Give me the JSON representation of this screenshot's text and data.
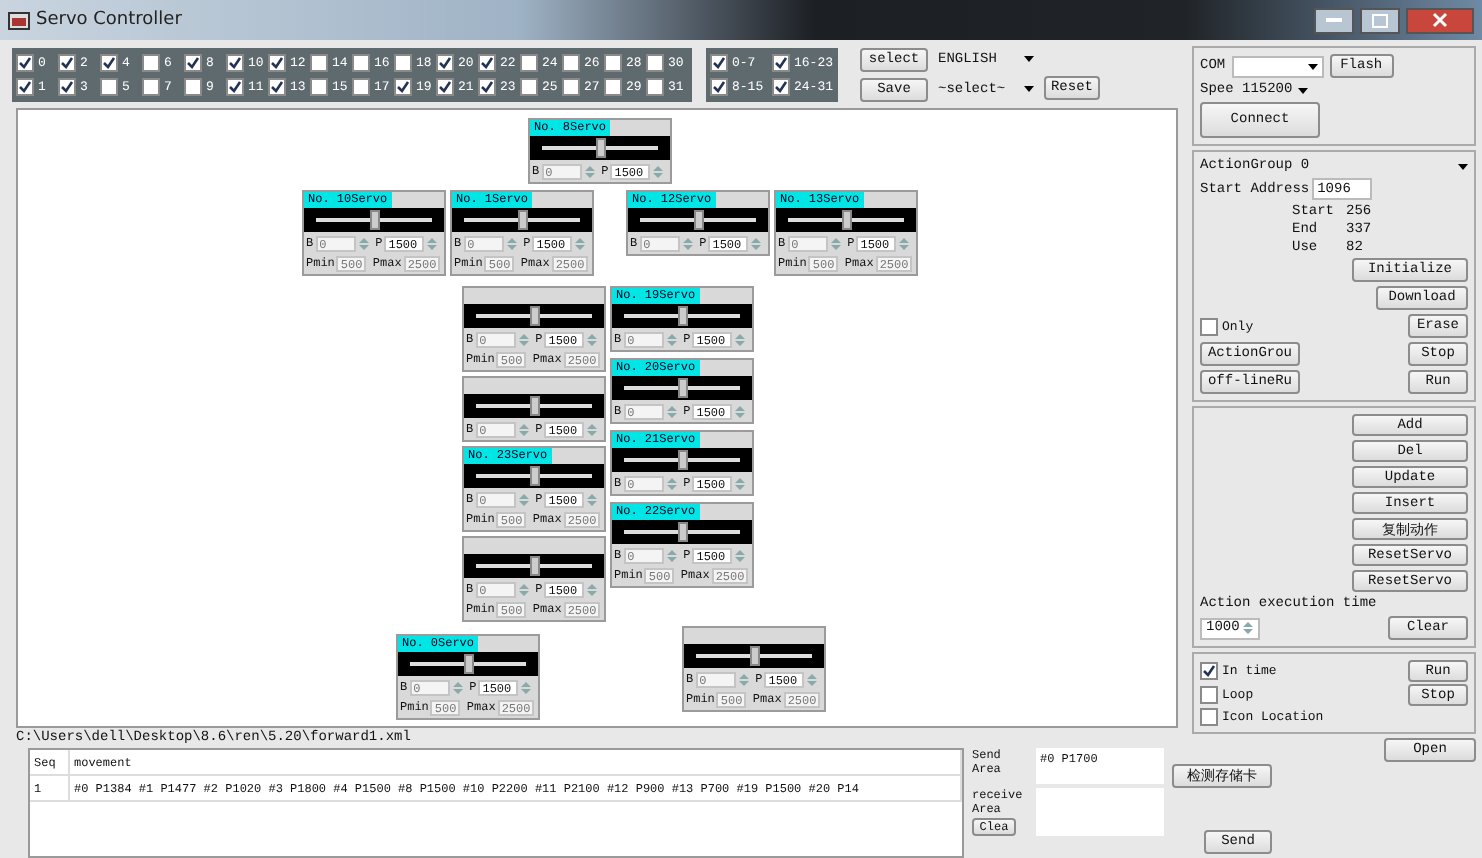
{
  "window": {
    "title": "Servo Controller"
  },
  "channels": [
    {
      "label": "0",
      "checked": true
    },
    {
      "label": "1",
      "checked": true
    },
    {
      "label": "2",
      "checked": true
    },
    {
      "label": "3",
      "checked": true
    },
    {
      "label": "4",
      "checked": true
    },
    {
      "label": "5",
      "checked": false
    },
    {
      "label": "6",
      "checked": false
    },
    {
      "label": "7",
      "checked": false
    },
    {
      "label": "8",
      "checked": true
    },
    {
      "label": "9",
      "checked": false
    },
    {
      "label": "10",
      "checked": true
    },
    {
      "label": "11",
      "checked": true
    },
    {
      "label": "12",
      "checked": true
    },
    {
      "label": "13",
      "checked": true
    },
    {
      "label": "14",
      "checked": false
    },
    {
      "label": "15",
      "checked": false
    },
    {
      "label": "16",
      "checked": false
    },
    {
      "label": "17",
      "checked": false
    },
    {
      "label": "18",
      "checked": false
    },
    {
      "label": "19",
      "checked": true
    },
    {
      "label": "20",
      "checked": true
    },
    {
      "label": "21",
      "checked": true
    },
    {
      "label": "22",
      "checked": true
    },
    {
      "label": "23",
      "checked": true
    },
    {
      "label": "24",
      "checked": false
    },
    {
      "label": "25",
      "checked": false
    },
    {
      "label": "26",
      "checked": false
    },
    {
      "label": "27",
      "checked": false
    },
    {
      "label": "28",
      "checked": false
    },
    {
      "label": "29",
      "checked": false
    },
    {
      "label": "30",
      "checked": false
    },
    {
      "label": "31",
      "checked": false
    }
  ],
  "channel_groups": [
    {
      "label": "0-7",
      "checked": true
    },
    {
      "label": "8-15",
      "checked": true
    },
    {
      "label": "16-23",
      "checked": true
    },
    {
      "label": "24-31",
      "checked": true
    }
  ],
  "toolbar": {
    "select_button": "select",
    "save_button": "Save",
    "language": "ENGLISH",
    "preset": "~select~",
    "reset_button": "Reset"
  },
  "servos": [
    {
      "title": "No. 8Servo",
      "b_label": "B",
      "b": "0",
      "p_label": "P",
      "p": "1500",
      "level": 0.5
    },
    {
      "title": "No. 10Servo",
      "b_label": "B",
      "b": "0",
      "p_label": "P",
      "p": "1500",
      "pmin_label": "Pmin",
      "pmin": "500",
      "pmax_label": "Pmax",
      "pmax": "2500",
      "level": 0.5
    },
    {
      "title": "No. 1Servo",
      "b_label": "B",
      "b": "0",
      "p_label": "P",
      "p": "1500",
      "pmin_label": "Pmin",
      "pmin": "500",
      "pmax_label": "Pmax",
      "pmax": "2500",
      "level": 0.5
    },
    {
      "title": "No. 12Servo",
      "b_label": "B",
      "b": "0",
      "p_label": "P",
      "p": "1500",
      "level": 0.5
    },
    {
      "title": "No. 13Servo",
      "b_label": "B",
      "b": "0",
      "p_label": "P",
      "p": "1500",
      "pmin_label": "Pmin",
      "pmin": "500",
      "pmax_label": "Pmax",
      "pmax": "2500",
      "level": 0.5
    },
    {
      "b_label": "B",
      "b": "0",
      "p_label": "P",
      "p": "1500",
      "pmin_label": "Pmin",
      "pmin": "500",
      "pmax_label": "Pmax",
      "pmax": "2500",
      "level": 0.5
    },
    {
      "title": "No. 19Servo",
      "b_label": "B",
      "b": "0",
      "p_label": "P",
      "p": "1500",
      "level": 0.5
    },
    {
      "b_label": "B",
      "b": "0",
      "p_label": "P",
      "p": "1500",
      "level": 0.5
    },
    {
      "title": "No. 20Servo",
      "b_label": "B",
      "b": "0",
      "p_label": "P",
      "p": "1500",
      "level": 0.5
    },
    {
      "title": "No. 23Servo",
      "b_label": "B",
      "b": "0",
      "p_label": "P",
      "p": "1500",
      "pmin_label": "Pmin",
      "pmin": "500",
      "pmax_label": "Pmax",
      "pmax": "2500",
      "level": 0.5
    },
    {
      "title": "No. 21Servo",
      "b_label": "B",
      "b": "0",
      "p_label": "P",
      "p": "1500",
      "level": 0.5
    },
    {
      "b_label": "B",
      "b": "0",
      "p_label": "P",
      "p": "1500",
      "pmin_label": "Pmin",
      "pmin": "500",
      "pmax_label": "Pmax",
      "pmax": "2500",
      "level": 0.5
    },
    {
      "title": "No. 22Servo",
      "b_label": "B",
      "b": "0",
      "p_label": "P",
      "p": "1500",
      "pmin_label": "Pmin",
      "pmin": "500",
      "pmax_label": "Pmax",
      "pmax": "2500",
      "level": 0.5
    },
    {
      "title": "No. 0Servo",
      "b_label": "B",
      "b": "0",
      "p_label": "P",
      "p": "1500",
      "pmin_label": "Pmin",
      "pmin": "500",
      "pmax_label": "Pmax",
      "pmax": "2500",
      "level": 0.5
    },
    {
      "b_label": "B",
      "b": "0",
      "p_label": "P",
      "p": "1500",
      "pmin_label": "Pmin",
      "pmin": "500",
      "pmax_label": "Pmax",
      "pmax": "2500",
      "level": 0.5
    }
  ],
  "file_path": "C:\\Users\\dell\\Desktop\\8.6\\ren\\5.20\\forward1.xml",
  "table": {
    "columns": [
      "Seq",
      "movement"
    ],
    "rows": [
      {
        "seq": "1",
        "movement": "#0 P1384 #1 P1477 #2 P1020 #3 P1800 #4 P1500 #8 P1500 #10 P2200 #11 P2100 #12 P900 #13 P700 #19 P1500 #20 P14"
      }
    ]
  },
  "send": {
    "send_label": "Send Area",
    "send_value": "#0 P1700",
    "receive_label": "receive Area",
    "clear_button": "Clea",
    "card_button": "检测存储卡",
    "send_button": "Send"
  },
  "connection": {
    "port_label": "COM",
    "flash_button": "Flash",
    "baud": "Spee 115200",
    "connect_button": "Connect"
  },
  "action_group": {
    "group": "ActionGroup 0",
    "address_label": "Start Address",
    "address": "1096",
    "stats": [
      {
        "label": "Start",
        "value": "256"
      },
      {
        "label": "End",
        "value": "337"
      },
      {
        "label": "Use",
        "value": "82"
      }
    ],
    "initialize_button": "Initialize",
    "download_button": "Download",
    "only": {
      "label": "Only",
      "checked": false
    },
    "erase_button": "Erase",
    "action_button": "ActionGrou",
    "stop_button": "Stop",
    "offline_button": "off-lineRu",
    "run_button": "Run"
  },
  "edit_buttons": [
    "Add",
    "Del",
    "Update",
    "Insert",
    "复制动作",
    "ResetServo",
    "ResetServo"
  ],
  "execution": {
    "label": "Action execution time",
    "value": "1000",
    "clear_button": "Clear"
  },
  "run": {
    "options": [
      {
        "label": "In time",
        "checked": true
      },
      {
        "label": "Loop",
        "checked": false
      },
      {
        "label": "Icon Location",
        "checked": false
      }
    ],
    "run_button": "Run",
    "stop_button": "Stop"
  },
  "open_button": "Open"
}
